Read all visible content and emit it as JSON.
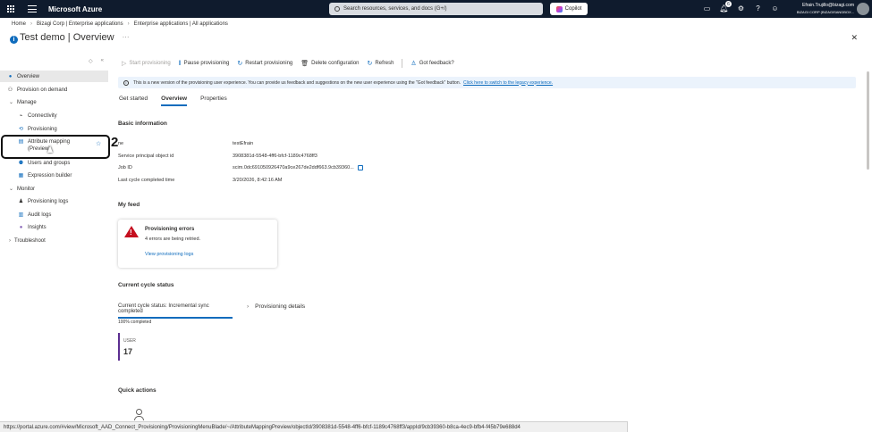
{
  "topbar": {
    "brand": "Microsoft Azure",
    "search_placeholder": "Search resources, services, and docs (G+/)",
    "copilot": "Copilot",
    "notification_count": "6",
    "account_email": "Efrain.Trujillo@bizagi.com",
    "account_org": "BIZAGI CORP (BIZAGISANDBOX..."
  },
  "breadcrumb": [
    "Home",
    "Bizagi Corp | Enterprise applications",
    "Enterprise applications | All applications"
  ],
  "page": {
    "title": "Test demo | Overview",
    "ellipsis": "···",
    "close": "✕"
  },
  "sidebar": {
    "items": [
      {
        "label": "Overview"
      },
      {
        "label": "Provision on demand"
      },
      {
        "label": "Manage"
      },
      {
        "label": "Connectivity"
      },
      {
        "label": "Provisioning"
      },
      {
        "label": "Attribute mapping",
        "label2": "(Preview)"
      },
      {
        "label": "Users and groups"
      },
      {
        "label": "Expression builder"
      },
      {
        "label": "Monitor"
      },
      {
        "label": "Provisioning logs"
      },
      {
        "label": "Audit logs"
      },
      {
        "label": "Insights"
      },
      {
        "label": "Troubleshoot"
      }
    ],
    "annotation": "2"
  },
  "toolbar": {
    "start": "Start provisioning",
    "pause": "Pause provisioning",
    "restart": "Restart provisioning",
    "delete": "Delete configuration",
    "refresh": "Refresh",
    "feedback": "Got feedback?"
  },
  "banner": {
    "text": "This is a new version of the provisioning user experience. You can provide us feedback and suggestions on the new user experience using the \"Got feedback\" button.",
    "link": "Click here to switch to the legacy experience."
  },
  "tabs": [
    "Get started",
    "Overview",
    "Properties"
  ],
  "basic_info": {
    "heading": "Basic information",
    "rows": [
      {
        "k": "ne",
        "v": "testEfrain"
      },
      {
        "k": "Service principal object id",
        "v": "3908381d-5548-4ff6-bfcf-1189c4768ff3"
      },
      {
        "k": "Job ID",
        "v": "scim.0dc691050926470a9ce267de2ddf663.9cb39360..."
      },
      {
        "k": "Last cycle completed time",
        "v": "3/20/2026, 8:42:16 AM"
      }
    ]
  },
  "feed": {
    "heading": "My feed",
    "card_title": "Provisioning errors",
    "card_sub": "4 errors are being retried.",
    "card_link": "View provisioning logs"
  },
  "cycle": {
    "heading": "Current cycle status",
    "status": "Current cycle status: Incremental sync completed",
    "details": "Provisioning details",
    "percent": "100% completed",
    "progress": 1.0,
    "stat_label": "USER",
    "stat_value": "17"
  },
  "quick_actions": {
    "heading": "Quick actions"
  },
  "statusbar": {
    "url": "https://portal.azure.com/#view/Microsoft_AAD_Connect_Provisioning/ProvisioningMenuBlade/~/AttributeMappingPreview/objectId/3908381d-5548-4ff6-bfcf-1189c4768ff3/appId/9cb39360-b8ca-4ec9-bfb4-f45b79e688d4"
  },
  "colors": {
    "accent": "#0f6cbd",
    "topbar": "#0f1b2d",
    "error": "#c50f1f",
    "stat_bar": "#5c2e91"
  }
}
